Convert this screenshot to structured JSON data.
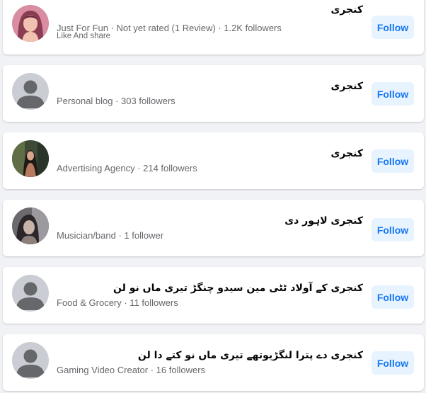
{
  "results": [
    {
      "name": "کنجری",
      "meta": "Just For Fun · Not yet rated (1 Review) · 1.2K followers",
      "sub": "Like And share",
      "action": "Follow",
      "avatar": "girl-photo"
    },
    {
      "name": "کنجری",
      "meta": "Personal blog · 303 followers",
      "sub": "",
      "action": "Follow",
      "avatar": "default-profile"
    },
    {
      "name": "کنجری",
      "meta": "Advertising Agency · 214 followers",
      "sub": "",
      "action": "Follow",
      "avatar": "woman-photo"
    },
    {
      "name": "کنجری لاہور دی",
      "meta": "Musician/band · 1 follower",
      "sub": "",
      "action": "Follow",
      "avatar": "girl-photo-dark"
    },
    {
      "name": "کنجری کے آولاد ٹٹی مین سیدو چنگڑ تیری ماں نو لن",
      "meta": "Food & Grocery · 11 followers",
      "sub": "",
      "action": "Follow",
      "avatar": "default-profile"
    },
    {
      "name": "کنجری دے پترا لنگڑیوتھے تیری ماں نو کتے دا لن",
      "meta": "Gaming Video Creator · 16 followers",
      "sub": "",
      "action": "Follow",
      "avatar": "default-profile"
    }
  ],
  "colors": {
    "accent": "#1877f2",
    "button_bg": "#e7f3ff",
    "secondary_text": "#65676b",
    "page_bg": "#f0f2f5"
  }
}
